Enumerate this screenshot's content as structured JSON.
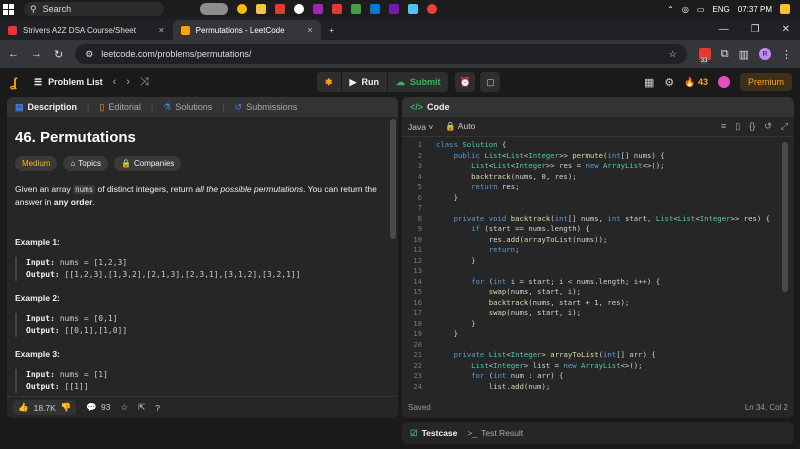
{
  "taskbar": {
    "search_placeholder": "Search",
    "lang": "ENG",
    "time": "07:37 PM"
  },
  "browser": {
    "tabs": [
      {
        "label": "Strivers A2Z DSA Course/Sheet",
        "icon_color": "#e53935"
      },
      {
        "label": "Permutations - LeetCode",
        "icon_color": "#ffa116"
      }
    ],
    "url": "leetcode.com/problems/permutations/",
    "ext_badge": "33",
    "profile_initial": "R"
  },
  "lc_nav": {
    "problem_list": "Problem List",
    "run": "Run",
    "submit": "Submit",
    "streak": "43",
    "premium": "Premium"
  },
  "left_tabs": [
    "Description",
    "Editorial",
    "Solutions",
    "Submissions"
  ],
  "problem": {
    "title": "46. Permutations",
    "difficulty": "Medium",
    "topics": "Topics",
    "companies": "Companies",
    "desc_before": "Given an array ",
    "desc_code": "nums",
    "desc_mid": " of distinct integers, return ",
    "desc_em": "all the possible permutations",
    "desc_after": ". You can return the answer in ",
    "desc_bold": "any order",
    "desc_end": ".",
    "examples": [
      {
        "title": "Example 1:",
        "input": "nums = [1,2,3]",
        "output": "[[1,2,3],[1,3,2],[2,1,3],[2,3,1],[3,1,2],[3,2,1]]"
      },
      {
        "title": "Example 2:",
        "input": "nums = [0,1]",
        "output": "[[0,1],[1,0]]"
      },
      {
        "title": "Example 3:",
        "input": "nums = [1]",
        "output": "[[1]]"
      }
    ],
    "input_label": "Input:",
    "output_label": "Output:",
    "likes": "18.7K",
    "comments": "93"
  },
  "code": {
    "header": "Code",
    "language": "Java",
    "mode": "Auto",
    "status": "Saved",
    "cursor": "Ln 34, Col 2"
  },
  "bottom": {
    "testcase": "Testcase",
    "result": "Test Result"
  }
}
